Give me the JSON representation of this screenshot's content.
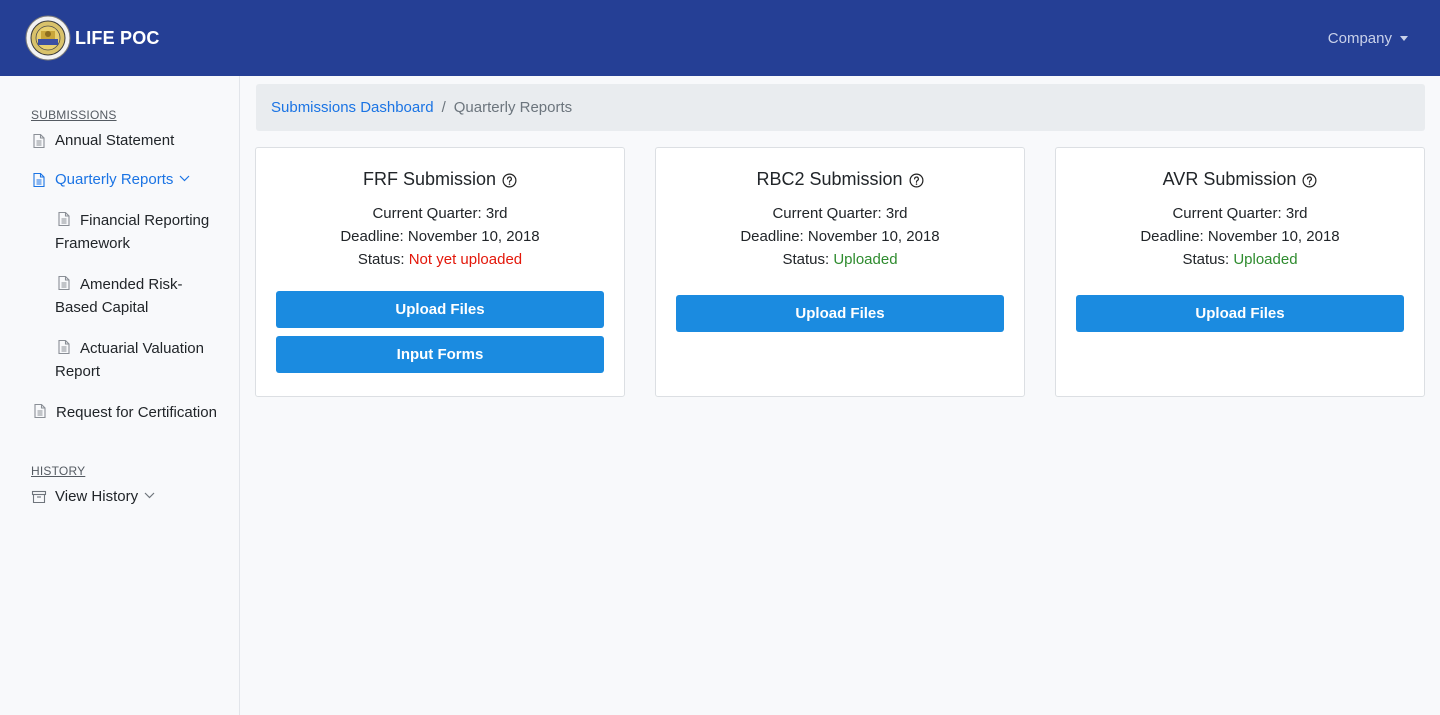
{
  "header": {
    "brand": "LIFE POC",
    "user_menu": "Company"
  },
  "sidebar": {
    "submissions_heading": "SUBMISSIONS",
    "items": [
      {
        "label": "Annual Statement"
      },
      {
        "label": "Quarterly Reports"
      },
      {
        "label": "Financial Reporting Framework"
      },
      {
        "label": "Amended Risk-Based Capital"
      },
      {
        "label": "Actuarial Valuation Report"
      },
      {
        "label": "Request for Certification"
      }
    ],
    "history_heading": "HISTORY",
    "history_items": [
      {
        "label": "View History"
      }
    ]
  },
  "breadcrumb": {
    "root": "Submissions Dashboard",
    "separator": "/",
    "current": "Quarterly Reports"
  },
  "cards": [
    {
      "title": "FRF Submission",
      "quarter": "Current Quarter: 3rd",
      "deadline": "Deadline: November 10, 2018",
      "status_label": "Status:",
      "status_value": "Not yet uploaded",
      "buttons": [
        "Upload Files",
        "Input Forms"
      ]
    },
    {
      "title": "RBC2 Submission",
      "quarter": "Current Quarter: 3rd",
      "deadline": "Deadline: November 10, 2018",
      "status_label": "Status:",
      "status_value": "Uploaded",
      "buttons": [
        "Upload Files"
      ]
    },
    {
      "title": "AVR Submission",
      "quarter": "Current Quarter: 3rd",
      "deadline": "Deadline: November 10, 2018",
      "status_label": "Status:",
      "status_value": "Uploaded",
      "buttons": [
        "Upload Files"
      ]
    }
  ],
  "colors": {
    "navbar": "#253f95",
    "accent": "#1b74e4",
    "button": "#1b8be0",
    "status_error": "#e3170a",
    "status_ok": "#2e8b2e"
  }
}
